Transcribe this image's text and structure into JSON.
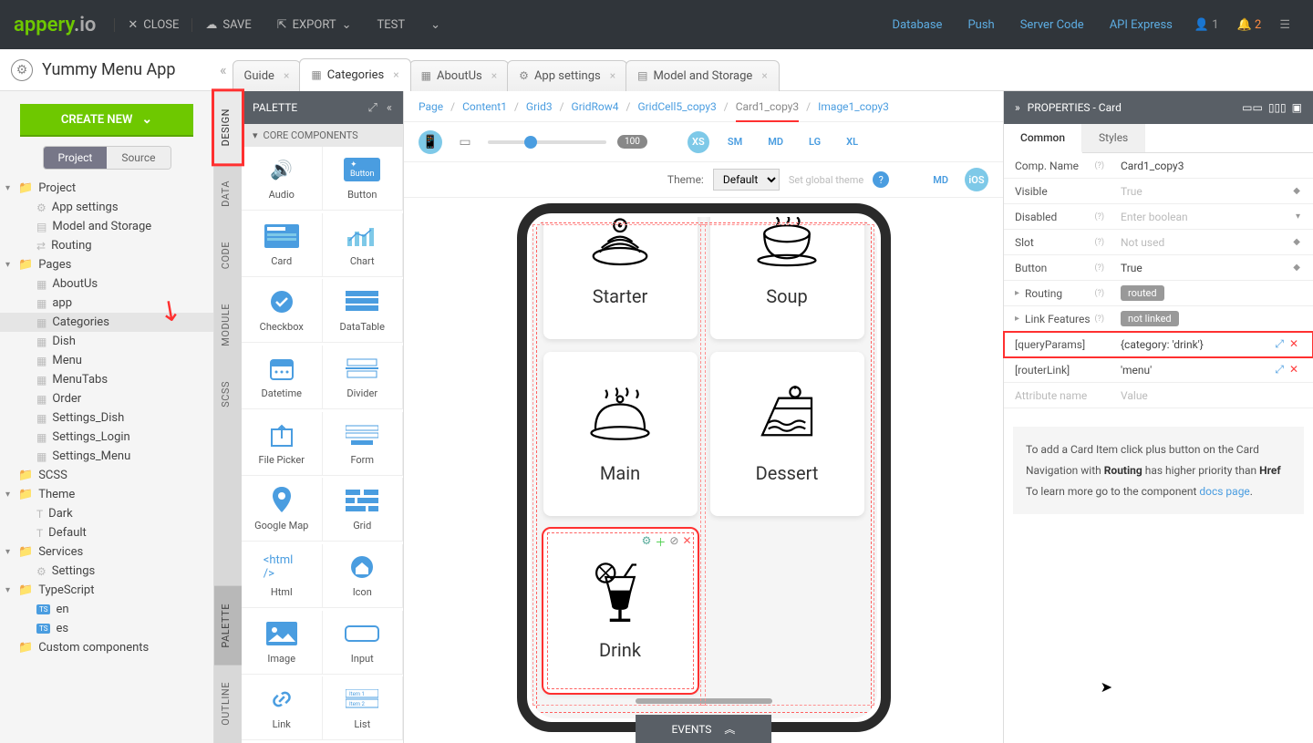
{
  "topbar": {
    "logo_main": "appery",
    "logo_suffix": ".io",
    "close": "CLOSE",
    "save": "SAVE",
    "export": "EXPORT",
    "test": "TEST",
    "links": [
      "Database",
      "Push",
      "Server Code",
      "API Express"
    ],
    "user_count": "1",
    "bell_count": "2"
  },
  "app_name": "Yummy Menu App",
  "create_new": "CREATE NEW",
  "toggle": {
    "project": "Project",
    "source": "Source"
  },
  "tree": {
    "project": "Project",
    "app_settings": "App settings",
    "model_storage": "Model and Storage",
    "routing": "Routing",
    "pages": "Pages",
    "aboutus": "AboutUs",
    "app": "app",
    "categories": "Categories",
    "dish": "Dish",
    "menu": "Menu",
    "menutabs": "MenuTabs",
    "order": "Order",
    "settings_dish": "Settings_Dish",
    "settings_login": "Settings_Login",
    "settings_menu": "Settings_Menu",
    "scss": "SCSS",
    "theme": "Theme",
    "dark": "Dark",
    "default": "Default",
    "services": "Services",
    "settings": "Settings",
    "typescript": "TypeScript",
    "en": "en",
    "es": "es",
    "custom": "Custom components"
  },
  "side_tabs": {
    "design": "DESIGN",
    "data": "DATA",
    "code": "CODE",
    "module": "MODULE",
    "scss": "SCSS",
    "palette": "PALETTE",
    "outline": "OUTLINE"
  },
  "palette": {
    "title": "PALETTE",
    "section": "CORE COMPONENTS",
    "items": [
      "Audio",
      "Button",
      "Card",
      "Chart",
      "Checkbox",
      "DataTable",
      "Datetime",
      "Divider",
      "File Picker",
      "Form",
      "Google Map",
      "Grid",
      "Html",
      "Icon",
      "Image",
      "Input",
      "Link",
      "List"
    ]
  },
  "tabs": [
    {
      "label": "Guide",
      "active": false
    },
    {
      "label": "Categories",
      "active": true
    },
    {
      "label": "AboutUs",
      "active": false
    },
    {
      "label": "App settings",
      "active": false
    },
    {
      "label": "Model and Storage",
      "active": false
    }
  ],
  "breadcrumb": [
    "Page",
    "Content1",
    "Grid3",
    "GridRow4",
    "GridCell5_copy3",
    "Card1_copy3",
    "Image1_copy3"
  ],
  "breadcrumb_current_index": 5,
  "toolbar": {
    "zoom": "100",
    "breakpoints": [
      "XS",
      "SM",
      "MD",
      "LG",
      "XL"
    ],
    "theme_label": "Theme:",
    "theme_value": "Default",
    "set_global": "Set global theme",
    "md": "MD",
    "ios": "iOS"
  },
  "cards": [
    {
      "label": "Starter"
    },
    {
      "label": "Soup"
    },
    {
      "label": "Main"
    },
    {
      "label": "Dessert"
    },
    {
      "label": "Drink",
      "selected": true
    }
  ],
  "events": "EVENTS",
  "props": {
    "title": "PROPERTIES - Card",
    "tab_common": "Common",
    "tab_styles": "Styles",
    "rows": {
      "comp_name": {
        "label": "Comp. Name",
        "value": "Card1_copy3"
      },
      "visible": {
        "label": "Visible",
        "value": "True"
      },
      "disabled": {
        "label": "Disabled",
        "value": "Enter boolean"
      },
      "slot": {
        "label": "Slot",
        "value": "Not used"
      },
      "button": {
        "label": "Button",
        "value": "True"
      },
      "routing": {
        "label": "Routing",
        "value": "routed"
      },
      "link_features": {
        "label": "Link Features",
        "value": "not linked"
      },
      "query_params": {
        "label": "[queryParams]",
        "value": "{category: 'drink'}"
      },
      "router_link": {
        "label": "[routerLink]",
        "value": "'menu'"
      },
      "attr_name": {
        "label": "Attribute name",
        "value": "Value"
      }
    },
    "info": {
      "line1a": "To add a Card Item click plus button on the Card",
      "line2a": "Navigation with ",
      "line2b": "Routing",
      "line2c": " has higher priority than ",
      "line2d": "Href",
      "line3a": "To learn more go to the component ",
      "line3b": "docs page",
      "line3c": "."
    }
  }
}
